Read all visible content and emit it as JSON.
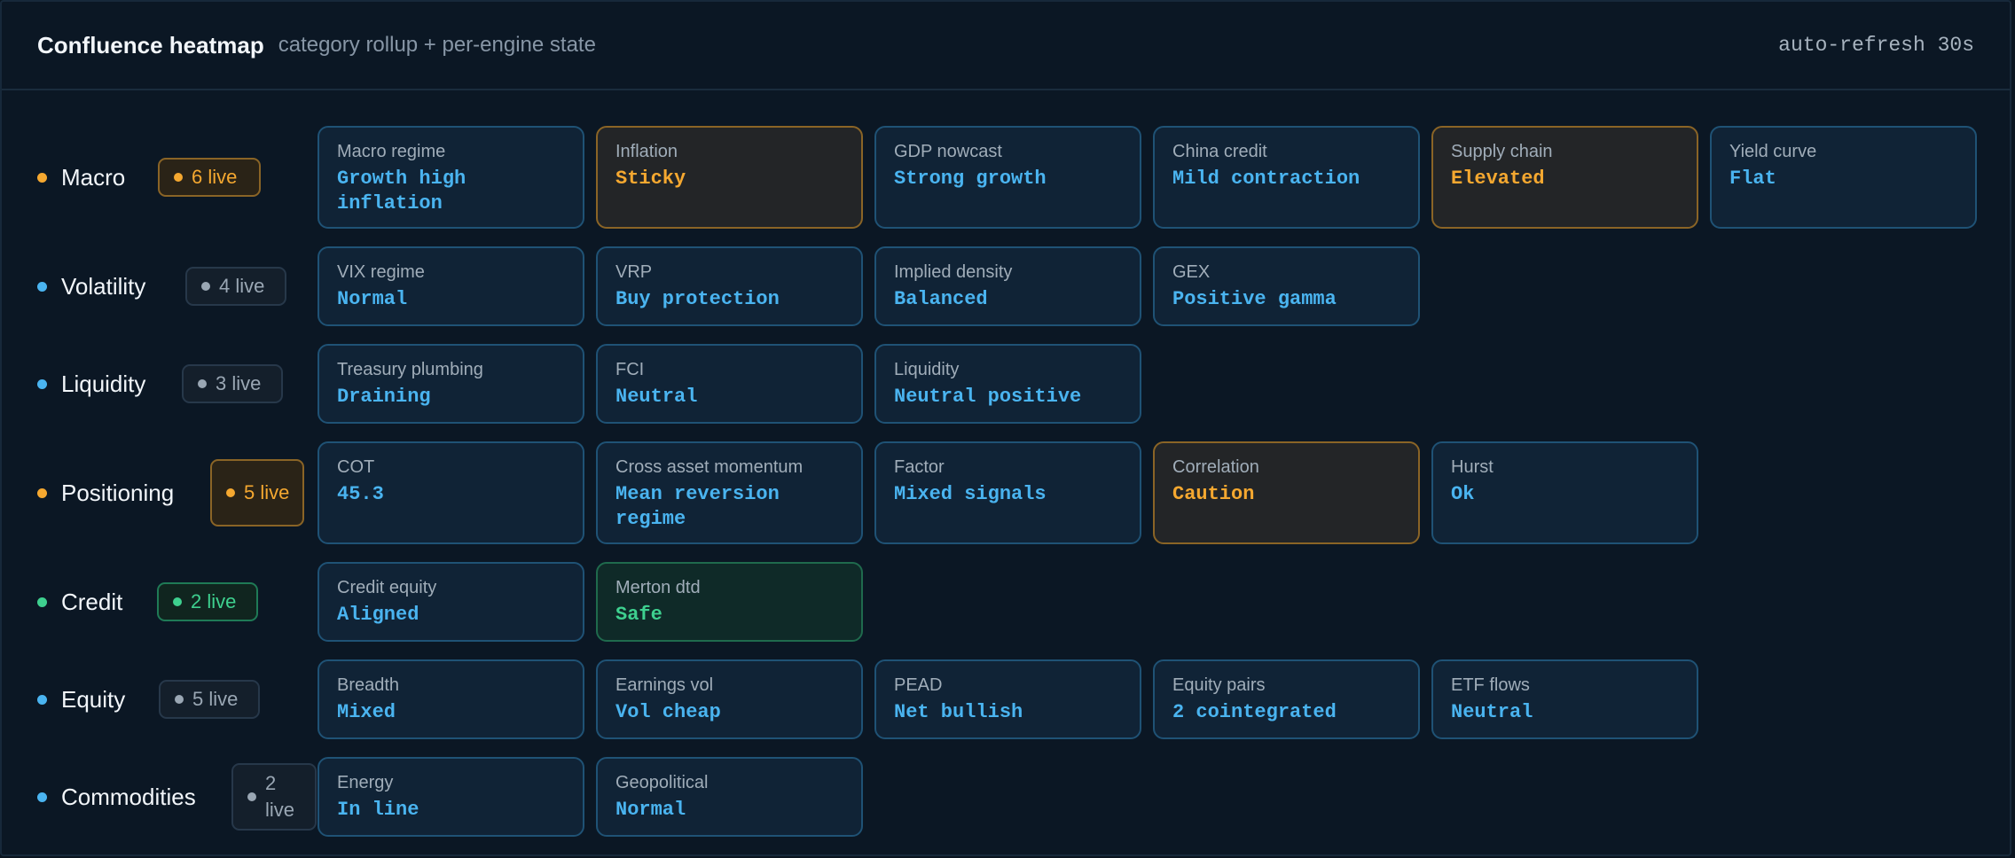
{
  "header": {
    "title": "Confluence heatmap",
    "subtitle": "category rollup + per-engine state",
    "refresh": "auto-refresh 30s"
  },
  "colors": {
    "blue": "#4ab4f0",
    "orange": "#f5a830",
    "green": "#3ed08f",
    "neutral": "#9aa7b4"
  },
  "rows": [
    {
      "name": "Macro",
      "dot": "orange",
      "badge": "6 live",
      "badge_style": "orange",
      "cells": [
        {
          "label": "Macro regime",
          "value": "Growth high inflation",
          "state": "blue"
        },
        {
          "label": "Inflation",
          "value": "Sticky",
          "state": "orange"
        },
        {
          "label": "GDP nowcast",
          "value": "Strong growth",
          "state": "blue"
        },
        {
          "label": "China credit",
          "value": "Mild contraction",
          "state": "blue"
        },
        {
          "label": "Supply chain",
          "value": "Elevated",
          "state": "orange"
        },
        {
          "label": "Yield curve",
          "value": "Flat",
          "state": "blue"
        }
      ]
    },
    {
      "name": "Volatility",
      "dot": "blue",
      "badge": "4 live",
      "badge_style": "neutral",
      "cells": [
        {
          "label": "VIX regime",
          "value": "Normal",
          "state": "blue"
        },
        {
          "label": "VRP",
          "value": "Buy protection",
          "state": "blue"
        },
        {
          "label": "Implied density",
          "value": "Balanced",
          "state": "blue"
        },
        {
          "label": "GEX",
          "value": "Positive gamma",
          "state": "blue"
        }
      ]
    },
    {
      "name": "Liquidity",
      "dot": "blue",
      "badge": "3 live",
      "badge_style": "neutral",
      "cells": [
        {
          "label": "Treasury plumbing",
          "value": "Draining",
          "state": "blue"
        },
        {
          "label": "FCI",
          "value": "Neutral",
          "state": "blue"
        },
        {
          "label": "Liquidity",
          "value": "Neutral positive",
          "state": "blue"
        }
      ]
    },
    {
      "name": "Positioning",
      "dot": "orange",
      "badge": "5 live",
      "badge_style": "orange",
      "cells": [
        {
          "label": "COT",
          "value": "45.3",
          "state": "blue"
        },
        {
          "label": "Cross asset momentum",
          "value": "Mean reversion regime",
          "state": "blue"
        },
        {
          "label": "Factor",
          "value": "Mixed signals",
          "state": "blue"
        },
        {
          "label": "Correlation",
          "value": "Caution",
          "state": "orange"
        },
        {
          "label": "Hurst",
          "value": "Ok",
          "state": "blue"
        }
      ]
    },
    {
      "name": "Credit",
      "dot": "green",
      "badge": "2 live",
      "badge_style": "green",
      "cells": [
        {
          "label": "Credit equity",
          "value": "Aligned",
          "state": "blue"
        },
        {
          "label": "Merton dtd",
          "value": "Safe",
          "state": "green"
        }
      ]
    },
    {
      "name": "Equity",
      "dot": "blue",
      "badge": "5 live",
      "badge_style": "neutral",
      "cells": [
        {
          "label": "Breadth",
          "value": "Mixed",
          "state": "blue"
        },
        {
          "label": "Earnings vol",
          "value": "Vol cheap",
          "state": "blue"
        },
        {
          "label": "PEAD",
          "value": "Net bullish",
          "state": "blue"
        },
        {
          "label": "Equity pairs",
          "value": "2 cointegrated",
          "state": "blue"
        },
        {
          "label": "ETF flows",
          "value": "Neutral",
          "state": "blue"
        }
      ]
    },
    {
      "name": "Commodities",
      "dot": "blue",
      "badge": "2 live",
      "badge_style": "neutral",
      "cells": [
        {
          "label": "Energy",
          "value": "In line",
          "state": "blue"
        },
        {
          "label": "Geopolitical",
          "value": "Normal",
          "state": "blue"
        }
      ]
    }
  ]
}
